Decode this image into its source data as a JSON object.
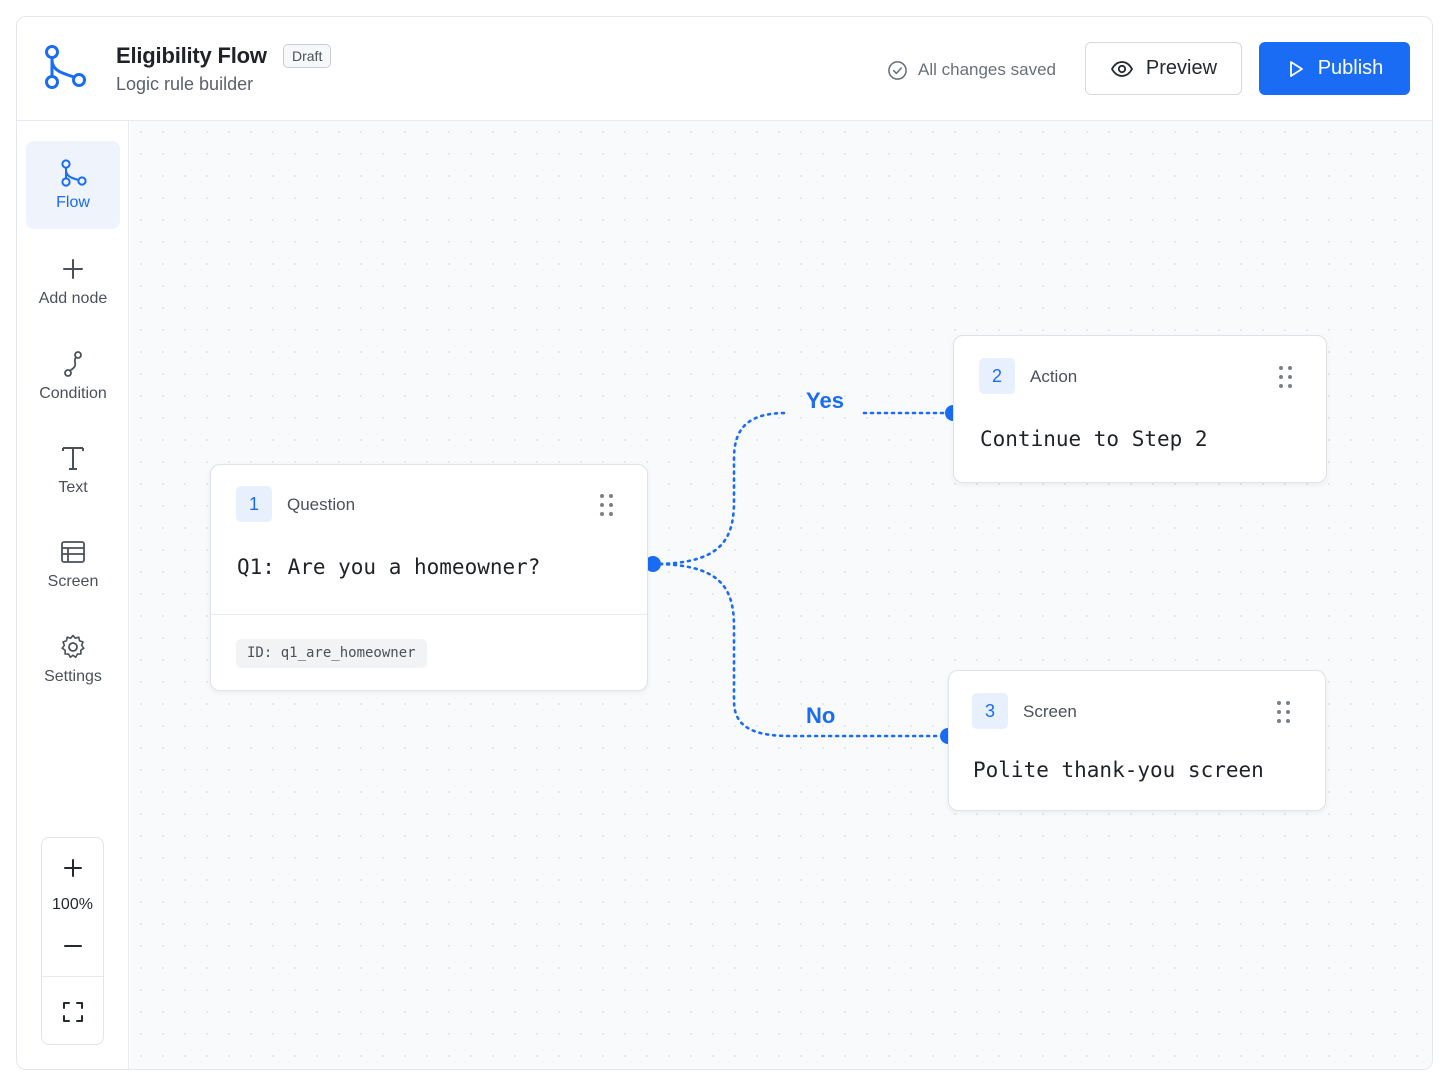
{
  "header": {
    "title": "Eligibility Flow",
    "badge": "Draft",
    "subtitle": "Logic rule builder",
    "status": "All changes saved",
    "preview_label": "Preview",
    "publish_label": "Publish"
  },
  "sidebar": {
    "items": [
      {
        "label": "Flow",
        "icon": "flow-icon",
        "active": true
      },
      {
        "label": "Add node",
        "icon": "plus-icon"
      },
      {
        "label": "Condition",
        "icon": "condition-icon"
      },
      {
        "label": "Text",
        "icon": "text-icon"
      },
      {
        "label": "Screen",
        "icon": "screen-icon"
      },
      {
        "label": "Settings",
        "icon": "gear-icon"
      }
    ],
    "zoom": {
      "level": "100%",
      "icons": [
        "zoom-in-icon",
        "zoom-out-icon",
        "fit-screen-icon"
      ]
    }
  },
  "nodes": [
    {
      "number": "1",
      "type": "Question",
      "text": "Q1: Are you a homeowner?",
      "id_label": "ID: q1_are_homeowner"
    },
    {
      "number": "2",
      "type": "Action",
      "text": "Continue to Step 2"
    },
    {
      "number": "3",
      "type": "Screen",
      "text": "Polite thank-you screen"
    }
  ],
  "branches": {
    "yes": "Yes",
    "no": "No"
  },
  "colors": {
    "accent": "#1a6cf5",
    "canvas": "#f9fafc",
    "border": "#dfe2e6"
  }
}
